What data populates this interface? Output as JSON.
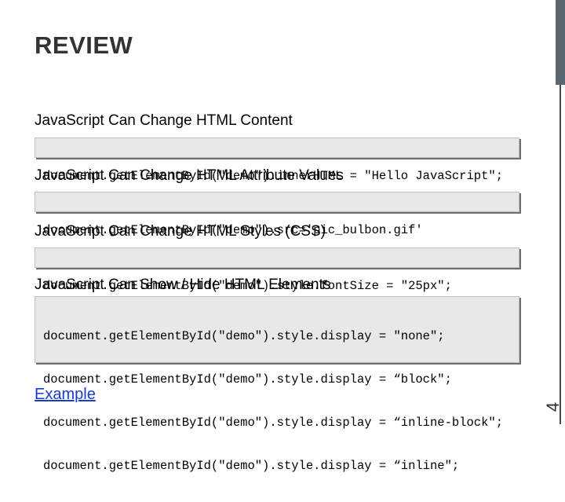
{
  "title": "REVIEW",
  "slide_number": "4",
  "sections": [
    {
      "heading": "JavaScript Can Change HTML Content",
      "code": [
        "document.getElementById(\"demo\").innerHTML = \"Hello JavaScript\";"
      ]
    },
    {
      "heading": "JavaScript Can Change HTML Attribute Values",
      "code": [
        "document.getElementById(\"demo\").src='pic_bulbon.gif'"
      ]
    },
    {
      "heading": "JavaScript Can Change HTML Styles (CSS)",
      "code": [
        "document.getElementById(\"demo\").style.fontSize = \"25px\";"
      ]
    },
    {
      "heading": "JavaScript Can Show / Hide HTML Elements",
      "code": [
        "document.getElementById(\"demo\").style.display = \"none\";",
        "document.getElementById(\"demo\").style.display = “block\";",
        "document.getElementById(\"demo\").style.display = “inline-block\";",
        "document.getElementById(\"demo\").style.display = “inline\";"
      ]
    }
  ],
  "example_link": "Example"
}
